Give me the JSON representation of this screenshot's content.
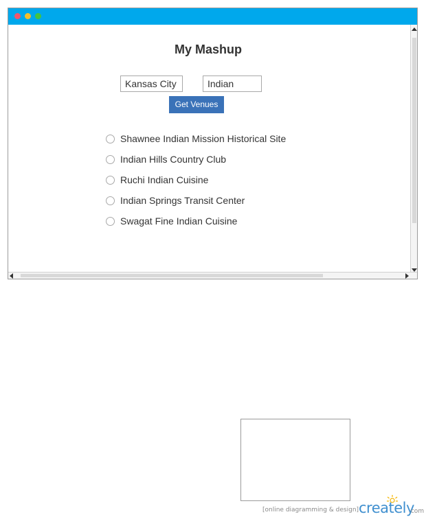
{
  "window": {
    "title": "My Mashup",
    "titlebar_color": "#00a8ec",
    "controls": [
      {
        "name": "close",
        "color": "#f0576b"
      },
      {
        "name": "minimize",
        "color": "#f5bf2a"
      },
      {
        "name": "maximize",
        "color": "#45c341"
      }
    ]
  },
  "search": {
    "city_value": "Kansas City",
    "query_value": "Indian",
    "button_label": "Get Venues",
    "button_color": "#3a72b8"
  },
  "results": [
    {
      "label": "Shawnee Indian Mission Historical Site"
    },
    {
      "label": "Indian Hills Country Club"
    },
    {
      "label": "Ruchi Indian Cuisine"
    },
    {
      "label": "Indian Springs Transit Center"
    },
    {
      "label": "Swagat Fine Indian Cuisine"
    }
  ],
  "footer": {
    "tagline": "[online diagramming & design]",
    "brand": "creately",
    "brand_tld": ".com",
    "brand_color": "#3f8fcf"
  }
}
